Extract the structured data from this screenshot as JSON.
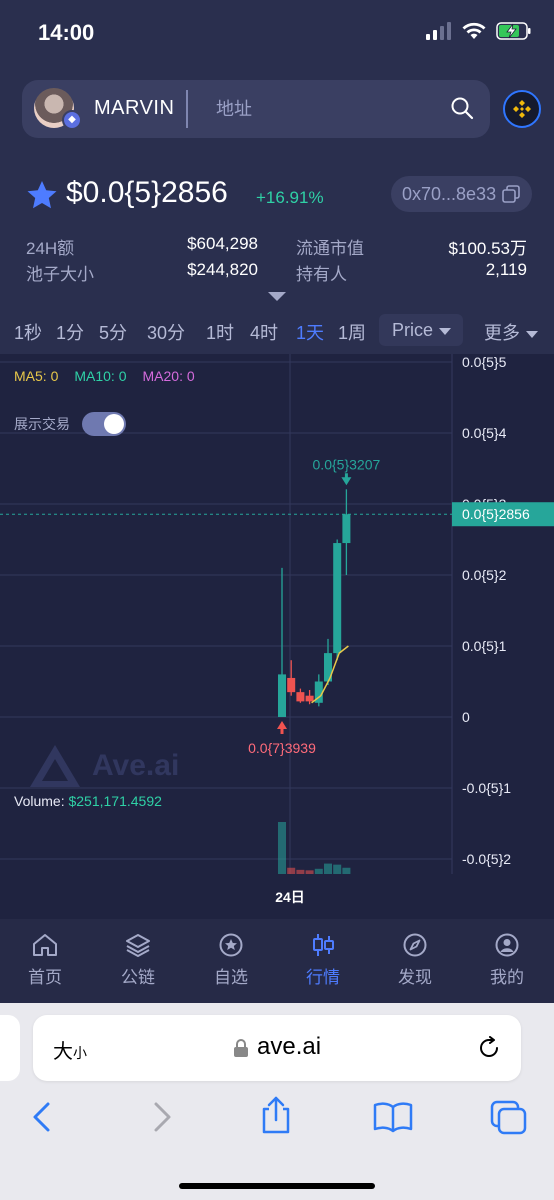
{
  "status_bar": {
    "time": "14:00"
  },
  "header": {
    "token_name": "MARVIN",
    "search_placeholder": "地址"
  },
  "token": {
    "price": "$0.0{5}2856",
    "change": "+16.91%",
    "address": "0x70...8e33",
    "stats": [
      {
        "label": "24H额",
        "value": "$604,298"
      },
      {
        "label": "流通市值",
        "value": "$100.53万"
      },
      {
        "label": "池子大小",
        "value": "$244,820"
      },
      {
        "label": "持有人",
        "value": "2,119"
      }
    ]
  },
  "timeframes": [
    "1秒",
    "1分",
    "5分",
    "30分",
    "1时",
    "4时",
    "1天",
    "1周"
  ],
  "active_timeframe": "1天",
  "price_dropdown": "Price",
  "more_dropdown": "更多",
  "chart": {
    "ma": [
      {
        "label": "MA5: 0",
        "color": "#e8c84a"
      },
      {
        "label": "MA10: 0",
        "color": "#2fd1a6"
      },
      {
        "label": "MA20: 0",
        "color": "#d46bdc"
      }
    ],
    "show_trades_label": "展示交易",
    "show_trades_on": true,
    "watermark": "Ave.ai",
    "volume_label": "Volume:",
    "volume_value": "$251,171.4592",
    "x_label": "24日",
    "colors": {
      "up": "#26a69a",
      "down": "#ef5350",
      "line": "#e8c84a"
    }
  },
  "chart_data": {
    "type": "candlestick",
    "y_tick_labels": [
      "0.0{5}5",
      "0.0{5}4",
      "0.0{5}3",
      "0.0{5}2",
      "0.0{5}1",
      "0",
      "-0.0{5}1",
      "-0.0{5}2"
    ],
    "y_ticks": [
      5,
      4,
      3,
      2,
      1,
      0,
      -1,
      -2
    ],
    "ylim": [
      -2.2,
      5
    ],
    "y_unit_note": "values in units of 0.0{5}",
    "current_price_label": "0.0{5}2856",
    "current_price": 2.856,
    "high_annotation": "0.0{5}3207",
    "high_value": 3.207,
    "low_annotation": "0.0{7}3939",
    "low_value": 0.0,
    "candles": [
      {
        "o": 0.0,
        "h": 2.1,
        "l": 0.0,
        "c": 0.6,
        "dir": "up"
      },
      {
        "o": 0.55,
        "h": 0.8,
        "l": 0.3,
        "c": 0.35,
        "dir": "down"
      },
      {
        "o": 0.35,
        "h": 0.4,
        "l": 0.2,
        "c": 0.22,
        "dir": "down"
      },
      {
        "o": 0.22,
        "h": 0.38,
        "l": 0.18,
        "c": 0.3,
        "dir": "down"
      },
      {
        "o": 0.2,
        "h": 0.6,
        "l": 0.15,
        "c": 0.5,
        "dir": "up"
      },
      {
        "o": 0.5,
        "h": 1.1,
        "l": 0.45,
        "c": 0.9,
        "dir": "up"
      },
      {
        "o": 0.9,
        "h": 2.5,
        "l": 0.8,
        "c": 2.45,
        "dir": "up"
      },
      {
        "o": 2.45,
        "h": 3.207,
        "l": 2.0,
        "c": 2.856,
        "dir": "up"
      }
    ],
    "volumes": [
      1.0,
      0.12,
      0.08,
      0.07,
      0.1,
      0.2,
      0.18,
      0.12
    ],
    "x_tick_labels": [
      "24日"
    ]
  },
  "bottom_nav": [
    {
      "label": "首页",
      "icon": "home-icon"
    },
    {
      "label": "公链",
      "icon": "layers-icon"
    },
    {
      "label": "自选",
      "icon": "star-circle-icon"
    },
    {
      "label": "行情",
      "icon": "candles-icon"
    },
    {
      "label": "发现",
      "icon": "compass-icon"
    },
    {
      "label": "我的",
      "icon": "user-icon"
    }
  ],
  "active_nav": "行情",
  "browser": {
    "text_size": "大",
    "text_size_small": "小",
    "url": "ave.ai"
  }
}
